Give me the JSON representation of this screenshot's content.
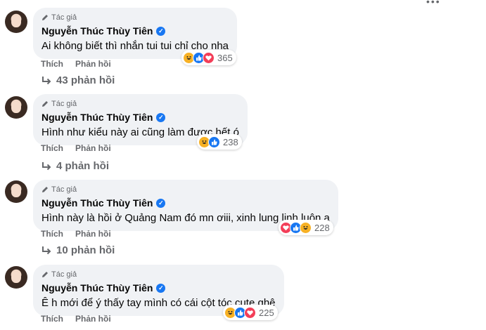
{
  "badge_label": "Tác giả",
  "action_like": "Thích",
  "action_reply": "Phản hồi",
  "colors": {
    "bubble": "#f0f2f5",
    "verified": "#1877f2",
    "muted": "#65676b"
  },
  "comments": [
    {
      "author": "Nguyễn Thúc Thùy Tiên",
      "text": "Ai không biết thì nhắn tui tui chỉ cho nha",
      "reactions": [
        "haha",
        "like",
        "love"
      ],
      "reaction_count": "365",
      "replies": "43 phản hồi"
    },
    {
      "author": "Nguyễn Thúc Thùy Tiên",
      "text": "Hình như kiểu này ai cũng làm được hết ó",
      "reactions": [
        "haha",
        "like"
      ],
      "reaction_count": "238",
      "replies": "4 phản hồi"
    },
    {
      "author": "Nguyễn Thúc Thùy Tiên",
      "text": "Hình này là hồi ở Quảng Nam đó mn ơiii, xinh lung linh luôn ạ",
      "reactions": [
        "love",
        "like",
        "haha"
      ],
      "reaction_count": "228",
      "replies": "10 phản hồi"
    },
    {
      "author": "Nguyễn Thúc Thùy Tiên",
      "text": "Ê h mới để ý thấy tay mình có cái cột tóc cute ghê",
      "reactions": [
        "haha",
        "like",
        "love"
      ],
      "reaction_count": "225",
      "replies": ""
    }
  ]
}
